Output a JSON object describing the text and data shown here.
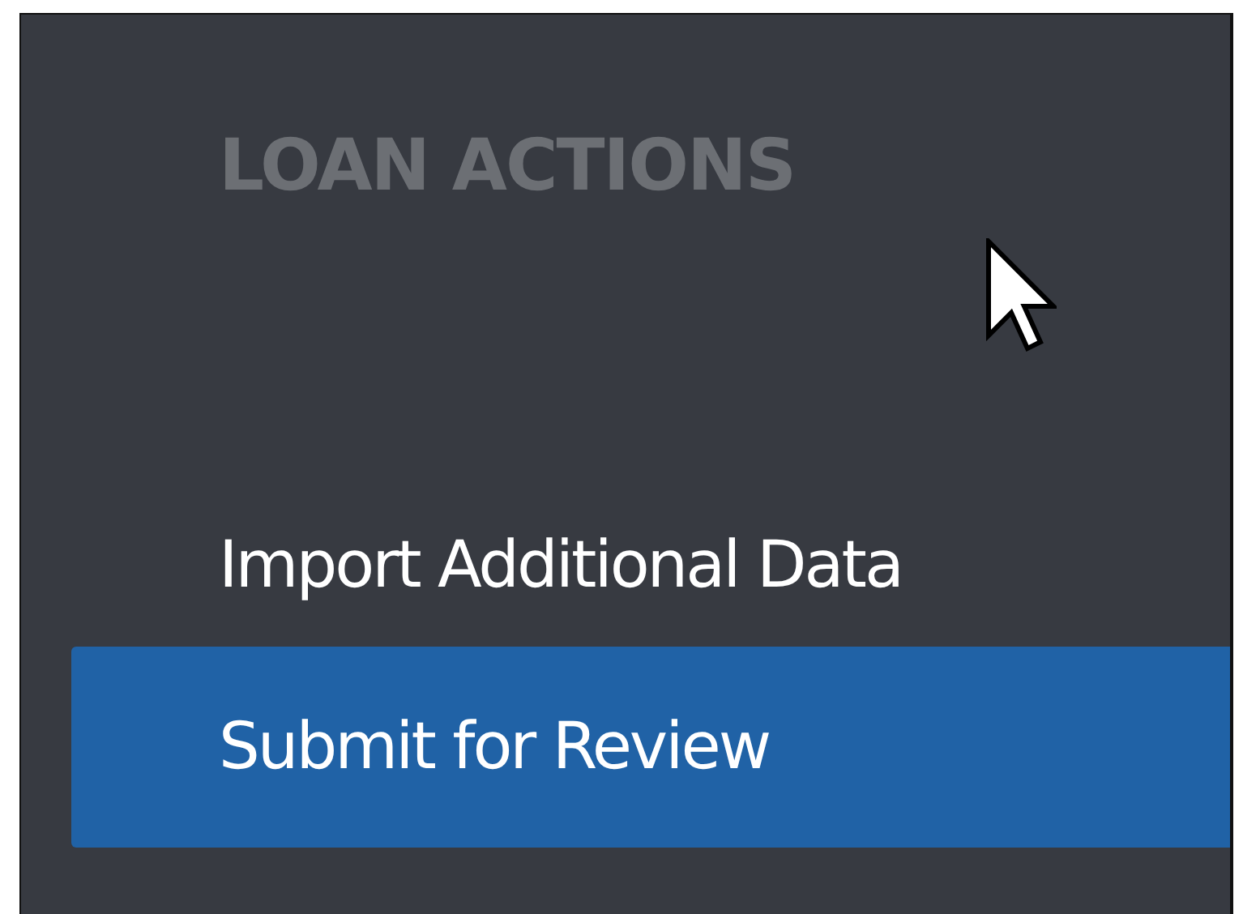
{
  "section_title": "LOAN ACTIONS",
  "items": [
    {
      "label": "Import Additional Data",
      "selected": false
    },
    {
      "label": "Submit for Review",
      "selected": true
    }
  ]
}
